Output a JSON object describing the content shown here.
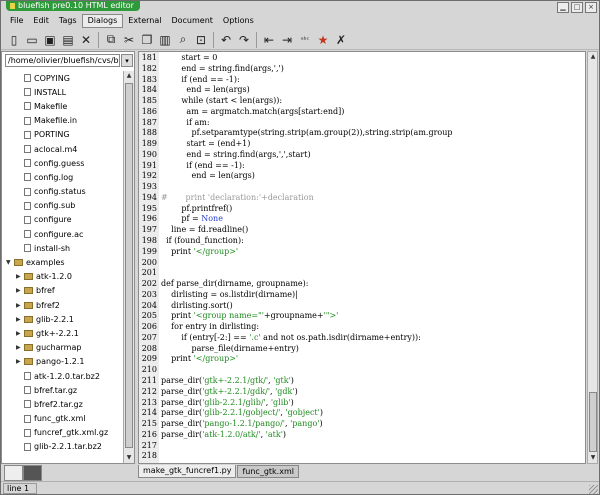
{
  "window": {
    "title": "bluefish pre0.10 HTML editor"
  },
  "menu": [
    "File",
    "Edit",
    "Tags",
    "Dialogs",
    "External",
    "Document",
    "Options"
  ],
  "toolbar": [
    {
      "name": "new-file-icon",
      "glyph": "▯"
    },
    {
      "name": "open-folder-icon",
      "glyph": "▭"
    },
    {
      "name": "save-icon",
      "glyph": "▣"
    },
    {
      "name": "save-as-icon",
      "glyph": "▤"
    },
    {
      "name": "close-icon",
      "glyph": "✕"
    },
    {
      "sep": true
    },
    {
      "name": "copy-window-icon",
      "glyph": "⧉"
    },
    {
      "name": "cut-icon",
      "glyph": "✂"
    },
    {
      "name": "copy-icon",
      "glyph": "❐"
    },
    {
      "name": "paste-icon",
      "glyph": "▥"
    },
    {
      "name": "find-icon",
      "glyph": "⌕"
    },
    {
      "name": "find-replace-icon",
      "glyph": "⊡"
    },
    {
      "sep": true
    },
    {
      "name": "undo-icon",
      "glyph": "↶"
    },
    {
      "name": "redo-icon",
      "glyph": "↷"
    },
    {
      "sep": true
    },
    {
      "name": "unindent-icon",
      "glyph": "⇤"
    },
    {
      "name": "indent-icon",
      "glyph": "⇥"
    },
    {
      "name": "spellcheck-icon",
      "glyph": "ᵃᵇᶜ"
    },
    {
      "name": "bookmark-star-icon",
      "glyph": "★",
      "color": "#c0391f"
    },
    {
      "name": "preferences-tools-icon",
      "glyph": "✗"
    }
  ],
  "filebrowser": {
    "path": "/home/olivier/bluefish/cvs/bluef",
    "items": [
      {
        "type": "file",
        "label": "COPYING",
        "indent": 1
      },
      {
        "type": "file",
        "label": "INSTALL",
        "indent": 1
      },
      {
        "type": "file",
        "label": "Makefile",
        "indent": 1
      },
      {
        "type": "file",
        "label": "Makefile.in",
        "indent": 1
      },
      {
        "type": "file",
        "label": "PORTING",
        "indent": 1
      },
      {
        "type": "file",
        "label": "aclocal.m4",
        "indent": 1
      },
      {
        "type": "file",
        "label": "config.guess",
        "indent": 1
      },
      {
        "type": "file",
        "label": "config.log",
        "indent": 1
      },
      {
        "type": "file",
        "label": "config.status",
        "indent": 1
      },
      {
        "type": "file",
        "label": "config.sub",
        "indent": 1
      },
      {
        "type": "file",
        "label": "configure",
        "indent": 1
      },
      {
        "type": "file",
        "label": "configure.ac",
        "indent": 1
      },
      {
        "type": "file",
        "label": "install-sh",
        "indent": 1
      },
      {
        "type": "dir",
        "label": "examples",
        "indent": 0,
        "open": true
      },
      {
        "type": "dir",
        "label": "atk-1.2.0",
        "indent": 1,
        "open": false
      },
      {
        "type": "dir",
        "label": "bfref",
        "indent": 1,
        "open": false
      },
      {
        "type": "dir",
        "label": "bfref2",
        "indent": 1,
        "open": false
      },
      {
        "type": "dir",
        "label": "glib-2.2.1",
        "indent": 1,
        "open": false
      },
      {
        "type": "dir",
        "label": "gtk+-2.2.1",
        "indent": 1,
        "open": false
      },
      {
        "type": "dir",
        "label": "gucharmap",
        "indent": 1,
        "open": false
      },
      {
        "type": "dir",
        "label": "pango-1.2.1",
        "indent": 1,
        "open": false
      },
      {
        "type": "file",
        "label": "atk-1.2.0.tar.bz2",
        "indent": 1
      },
      {
        "type": "file",
        "label": "bfref.tar.gz",
        "indent": 1
      },
      {
        "type": "file",
        "label": "bfref2.tar.gz",
        "indent": 1
      },
      {
        "type": "file",
        "label": "func_gtk.xml",
        "indent": 1
      },
      {
        "type": "file",
        "label": "funcref_gtk.xml.gz",
        "indent": 1
      },
      {
        "type": "file",
        "label": "glib-2.2.1.tar.bz2",
        "indent": 1
      }
    ]
  },
  "editor": {
    "lines": [
      {
        "n": "181",
        "segs": [
          {
            "t": "        start = 0"
          }
        ]
      },
      {
        "n": "182",
        "segs": [
          {
            "t": "        end = string.find(args,','"
          },
          {
            "t": ")"
          }
        ]
      },
      {
        "n": "183",
        "segs": [
          {
            "t": "        if (end == -1):"
          }
        ]
      },
      {
        "n": "184",
        "segs": [
          {
            "t": "          end = len(args)"
          }
        ]
      },
      {
        "n": "185",
        "segs": [
          {
            "t": "        while (start < len(args)):"
          }
        ]
      },
      {
        "n": "186",
        "segs": [
          {
            "t": "          am = argmatch.match(args[start:end])"
          }
        ]
      },
      {
        "n": "187",
        "segs": [
          {
            "t": "          if am:"
          }
        ]
      },
      {
        "n": "188",
        "segs": [
          {
            "t": "            pf.setparamtype(string.strip(am.group(2)),string.strip(am.group"
          }
        ]
      },
      {
        "n": "189",
        "segs": [
          {
            "t": "          start = (end+1)"
          }
        ]
      },
      {
        "n": "190",
        "segs": [
          {
            "t": "          end = string.find(args,',',start)"
          }
        ]
      },
      {
        "n": "191",
        "segs": [
          {
            "t": "          if (end == -1):"
          }
        ]
      },
      {
        "n": "192",
        "segs": [
          {
            "t": "            end = len(args)"
          }
        ]
      },
      {
        "n": "193",
        "segs": [
          {
            "t": ""
          }
        ]
      },
      {
        "n": "194",
        "segs": [
          {
            "t": "#       print 'declaration:'+declaration",
            "c": "#9a9a9a"
          }
        ]
      },
      {
        "n": "195",
        "segs": [
          {
            "t": "        pf.printfref()"
          }
        ]
      },
      {
        "n": "196",
        "segs": [
          {
            "t": "        pf = "
          },
          {
            "t": "None",
            "c": "#2a3fd0"
          }
        ]
      },
      {
        "n": "197",
        "segs": [
          {
            "t": "    line = fd.readline()"
          }
        ]
      },
      {
        "n": "198",
        "segs": [
          {
            "t": "  if (found_function):"
          }
        ]
      },
      {
        "n": "199",
        "segs": [
          {
            "t": "    print "
          },
          {
            "t": "'</group>'",
            "c": "#1f8a1f"
          }
        ]
      },
      {
        "n": "200",
        "segs": [
          {
            "t": ""
          }
        ]
      },
      {
        "n": "201",
        "segs": [
          {
            "t": ""
          }
        ]
      },
      {
        "n": "202",
        "segs": [
          {
            "t": "def parse_dir(dirname, groupname):"
          }
        ]
      },
      {
        "n": "203",
        "segs": [
          {
            "t": "    dirlisting = os.listdir(dirname)"
          },
          {
            "t": "|",
            "c": "#000"
          }
        ]
      },
      {
        "n": "204",
        "segs": [
          {
            "t": "    dirlisting.sort()"
          }
        ]
      },
      {
        "n": "205",
        "segs": [
          {
            "t": "    print "
          },
          {
            "t": "'<group name=\"'",
            "c": "#1f8a1f"
          },
          {
            "t": "+groupname+"
          },
          {
            "t": "'\">'",
            "c": "#1f8a1f"
          }
        ]
      },
      {
        "n": "206",
        "segs": [
          {
            "t": "    for entry in dirlisting:"
          }
        ]
      },
      {
        "n": "207",
        "segs": [
          {
            "t": "        if (entry[-2:] == "
          },
          {
            "t": "'.c'",
            "c": "#1f8a1f"
          },
          {
            "t": " and not os.path.isdir(dirname+entry)):"
          }
        ]
      },
      {
        "n": "208",
        "segs": [
          {
            "t": "            parse_file(dirname+entry)"
          }
        ]
      },
      {
        "n": "209",
        "segs": [
          {
            "t": "    print "
          },
          {
            "t": "'</group>'",
            "c": "#1f8a1f"
          }
        ]
      },
      {
        "n": "210",
        "segs": [
          {
            "t": ""
          }
        ]
      },
      {
        "n": "211",
        "segs": [
          {
            "t": "parse_dir("
          },
          {
            "t": "'gtk+-2.2.1/gtk/'",
            "c": "#1f8a1f"
          },
          {
            "t": ", "
          },
          {
            "t": "'gtk'",
            "c": "#1f8a1f"
          },
          {
            "t": ")"
          }
        ]
      },
      {
        "n": "212",
        "segs": [
          {
            "t": "parse_dir("
          },
          {
            "t": "'gtk+-2.2.1/gdk/'",
            "c": "#1f8a1f"
          },
          {
            "t": ", "
          },
          {
            "t": "'gdk'",
            "c": "#1f8a1f"
          },
          {
            "t": ")"
          }
        ]
      },
      {
        "n": "213",
        "segs": [
          {
            "t": "parse_dir("
          },
          {
            "t": "'glib-2.2.1/glib/'",
            "c": "#1f8a1f"
          },
          {
            "t": ", "
          },
          {
            "t": "'glib'",
            "c": "#1f8a1f"
          },
          {
            "t": ")"
          }
        ]
      },
      {
        "n": "214",
        "segs": [
          {
            "t": "parse_dir("
          },
          {
            "t": "'glib-2.2.1/gobject/'",
            "c": "#1f8a1f"
          },
          {
            "t": ", "
          },
          {
            "t": "'gobject'",
            "c": "#1f8a1f"
          },
          {
            "t": ")"
          }
        ]
      },
      {
        "n": "215",
        "segs": [
          {
            "t": "parse_dir("
          },
          {
            "t": "'pango-1.2.1/pango/'",
            "c": "#1f8a1f"
          },
          {
            "t": ", "
          },
          {
            "t": "'pango'",
            "c": "#1f8a1f"
          },
          {
            "t": ")"
          }
        ]
      },
      {
        "n": "216",
        "segs": [
          {
            "t": "parse_dir("
          },
          {
            "t": "'atk-1.2.0/atk/'",
            "c": "#1f8a1f"
          },
          {
            "t": ", "
          },
          {
            "t": "'atk'",
            "c": "#1f8a1f"
          },
          {
            "t": ")"
          }
        ]
      },
      {
        "n": "217",
        "segs": [
          {
            "t": ""
          }
        ]
      },
      {
        "n": "218",
        "segs": [
          {
            "t": ""
          }
        ]
      }
    ]
  },
  "tabs": [
    {
      "label": "make_gtk_funcref1.py",
      "active": true
    },
    {
      "label": "func_gtk.xml",
      "active": false
    }
  ],
  "status": {
    "text": "line  1"
  },
  "colors": {
    "titlebar": "#2f9a3a",
    "keyword_none": "#2a3fd0",
    "string": "#1f8a1f",
    "comment": "#9a9a9a",
    "bookmark_star": "#c0391f"
  }
}
